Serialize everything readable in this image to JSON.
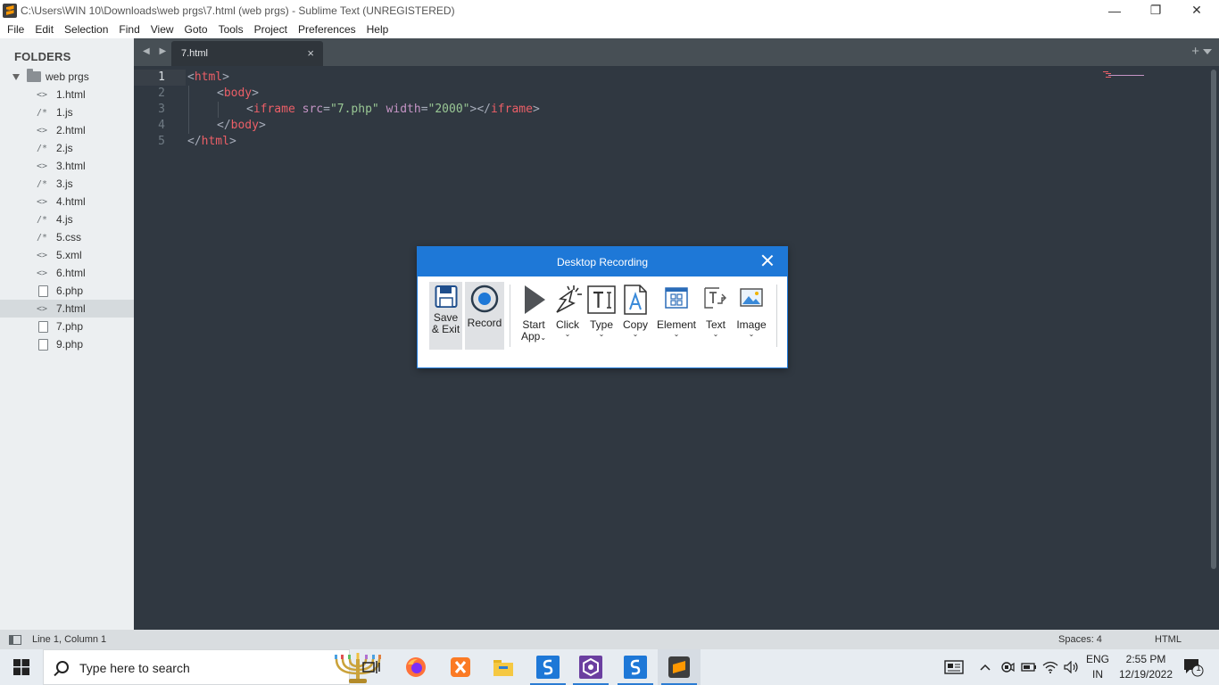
{
  "window": {
    "title": "C:\\Users\\WIN 10\\Downloads\\web prgs\\7.html (web prgs) - Sublime Text (UNREGISTERED)",
    "minimize": "—",
    "maximize": "❐",
    "close": "✕"
  },
  "menu": [
    "File",
    "Edit",
    "Selection",
    "Find",
    "View",
    "Goto",
    "Tools",
    "Project",
    "Preferences",
    "Help"
  ],
  "sidebar": {
    "heading": "FOLDERS",
    "root": "web prgs",
    "files": [
      {
        "name": "1.html",
        "icon": "<>"
      },
      {
        "name": "1.js",
        "icon": "/*"
      },
      {
        "name": "2.html",
        "icon": "<>"
      },
      {
        "name": "2.js",
        "icon": "/*"
      },
      {
        "name": "3.html",
        "icon": "<>"
      },
      {
        "name": "3.js",
        "icon": "/*"
      },
      {
        "name": "4.html",
        "icon": "<>"
      },
      {
        "name": "4.js",
        "icon": "/*"
      },
      {
        "name": "5.css",
        "icon": "/*"
      },
      {
        "name": "5.xml",
        "icon": "<>"
      },
      {
        "name": "6.html",
        "icon": "<>"
      },
      {
        "name": "6.php",
        "icon": "page"
      },
      {
        "name": "7.html",
        "icon": "<>",
        "selected": true
      },
      {
        "name": "7.php",
        "icon": "page"
      },
      {
        "name": "9.php",
        "icon": "page"
      }
    ]
  },
  "tabs": {
    "active": "7.html",
    "close": "×",
    "new": "+"
  },
  "editor": {
    "line_numbers": [
      "1",
      "2",
      "3",
      "4",
      "5"
    ],
    "current_line": "1",
    "code": {
      "l1": {
        "open": "<",
        "tag": "html",
        "close": ">"
      },
      "l2": {
        "open": "<",
        "tag": "body",
        "close": ">"
      },
      "l3": {
        "open": "<",
        "tag": "iframe",
        "sp1": " ",
        "attr1": "src",
        "eq1": "=",
        "val1": "\"7.php\"",
        "sp2": " ",
        "attr2": "width",
        "eq2": "=",
        "val2": "\"2000\"",
        "close": ">",
        "endopen": "</",
        "endtag": "iframe",
        "endclose": ">"
      },
      "l4": {
        "open": "</",
        "tag": "body",
        "close": ">"
      },
      "l5": {
        "open": "</",
        "tag": "html",
        "close": ">"
      }
    }
  },
  "statusbar": {
    "position": "Line 1, Column 1",
    "indentation": "Spaces: 4",
    "syntax": "HTML"
  },
  "recording_dialog": {
    "title": "Desktop Recording",
    "tools": {
      "save_exit": {
        "line1": "Save",
        "line2": "& Exit"
      },
      "record": {
        "line1": "Record"
      },
      "start_app": {
        "line1": "Start",
        "line2": "App"
      },
      "click": {
        "line1": "Click"
      },
      "type": {
        "line1": "Type"
      },
      "copy": {
        "line1": "Copy"
      },
      "element": {
        "line1": "Element"
      },
      "text": {
        "line1": "Text"
      },
      "image": {
        "line1": "Image"
      }
    },
    "caret": "⌄",
    "accent_color": "#1e78d7"
  },
  "taskbar": {
    "search_placeholder": "Type here to search",
    "language": {
      "line1": "ENG",
      "line2": "IN"
    },
    "clock": {
      "time": "2:55 PM",
      "date": "12/19/2022"
    },
    "notifications": "1"
  }
}
